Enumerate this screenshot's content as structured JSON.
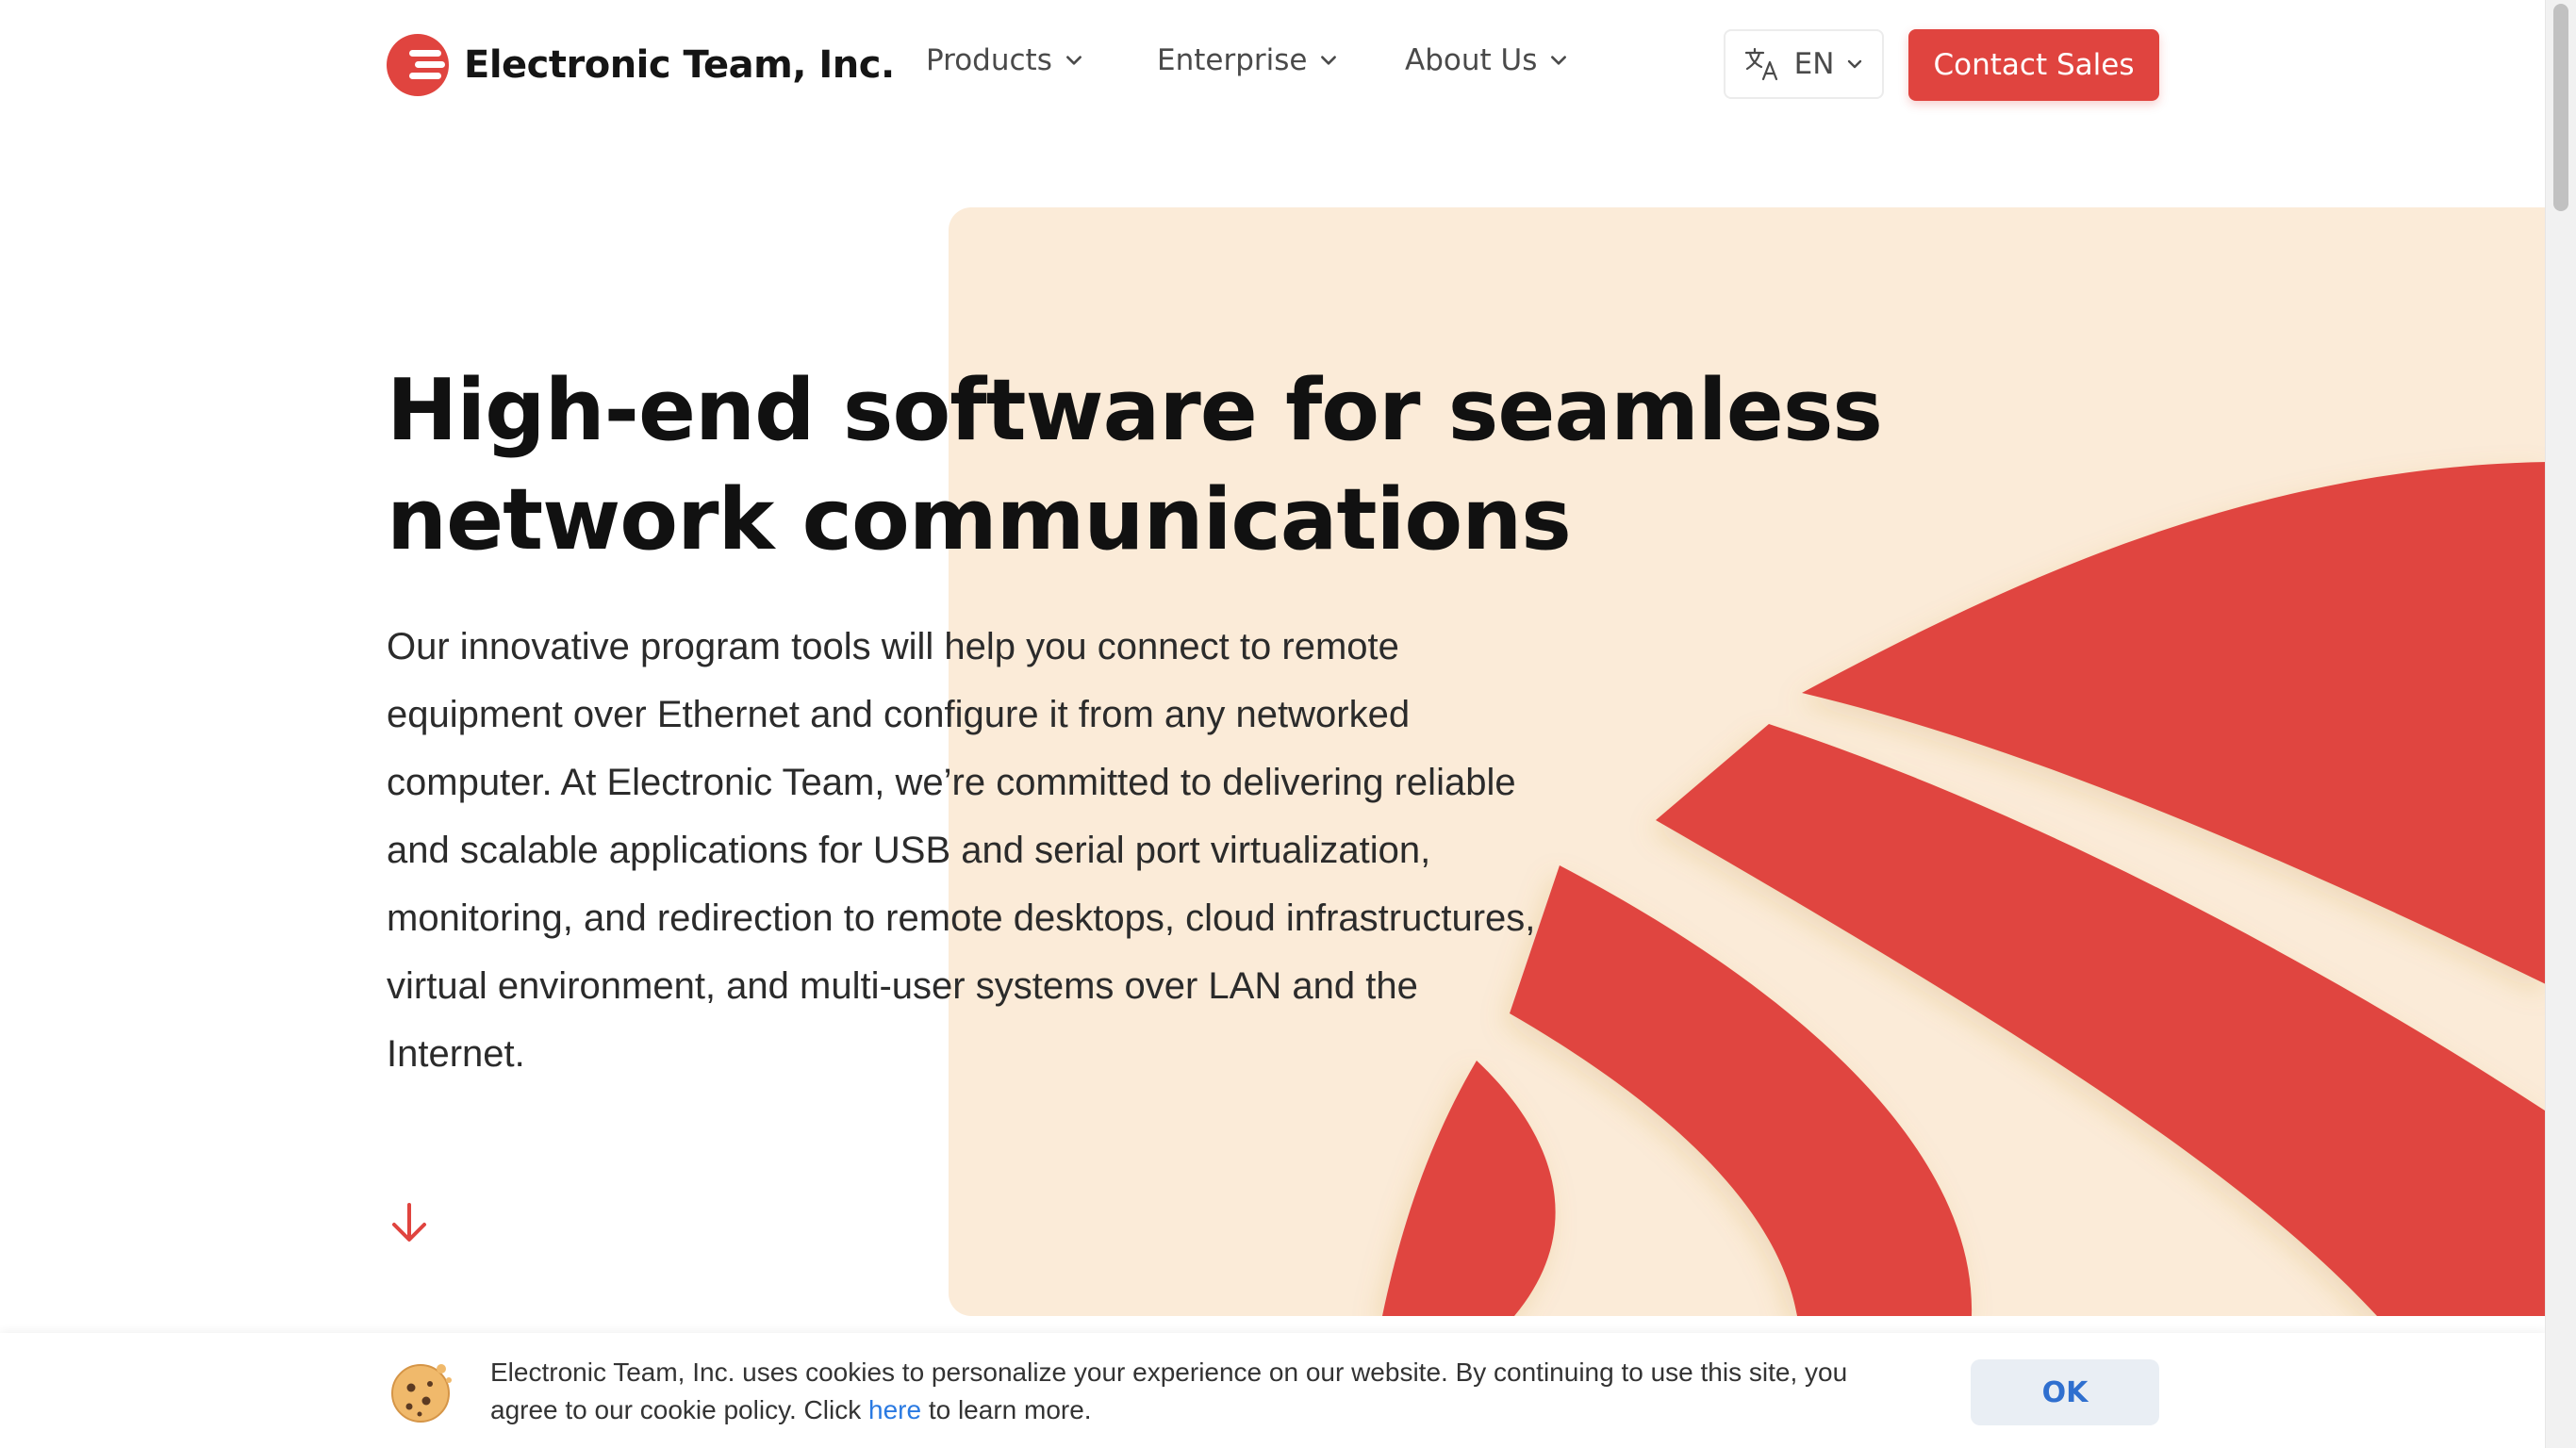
{
  "header": {
    "brand": "Electronic Team, Inc.",
    "nav": [
      {
        "label": "Products"
      },
      {
        "label": "Enterprise"
      },
      {
        "label": "About Us"
      }
    ],
    "language": "EN",
    "contact_label": "Contact Sales",
    "accent_color": "#e0443f"
  },
  "hero": {
    "headline_lines": [
      "High-end software for seamless",
      "network communications"
    ],
    "lead_lines": [
      "Our innovative program tools will help you connect to remote",
      "equipment over Ethernet and configure it from any networked",
      "computer. At Electronic Team, we’re committed to delivering reliable",
      "and scalable applications for USB and serial port virtualization,",
      "monitoring, and redirection to remote desktops, cloud infrastructures,",
      "virtual environment, and multi-user systems over LAN and the",
      "Internet."
    ],
    "background_color": "#fbebd8",
    "scroll_icon": "arrow-down-icon"
  },
  "cookie_banner": {
    "line1": "Electronic Team, Inc. uses cookies to personalize your experience on our website. By continuing to use this site, you",
    "line2_before": "agree to our cookie policy. Click ",
    "link": "here",
    "line2_after": " to learn more.",
    "ok_label": "OK",
    "icon": "cookie-icon"
  }
}
